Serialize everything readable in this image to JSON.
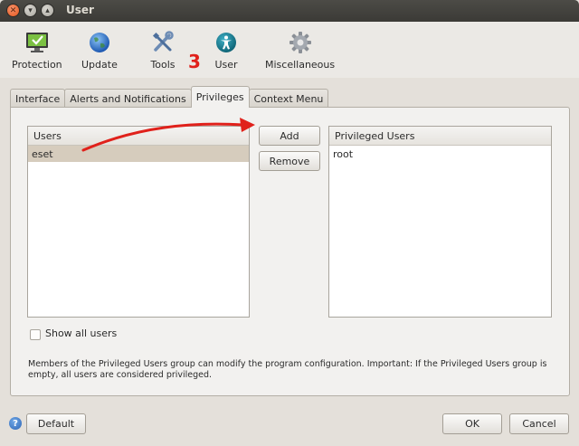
{
  "window": {
    "title": "User"
  },
  "toolbar": {
    "items": [
      {
        "label": "Protection",
        "icon": "monitor-check-icon"
      },
      {
        "label": "Update",
        "icon": "globe-icon"
      },
      {
        "label": "Tools",
        "icon": "tools-icon"
      },
      {
        "label": "User",
        "icon": "user-accessibility-icon"
      },
      {
        "label": "Miscellaneous",
        "icon": "gear-icon"
      }
    ],
    "step_number": "3"
  },
  "tabs": [
    {
      "label": "Interface"
    },
    {
      "label": "Alerts and Notifications"
    },
    {
      "label": "Privileges",
      "active": true
    },
    {
      "label": "Context Menu"
    }
  ],
  "users_list": {
    "header": "Users",
    "items": [
      "eset"
    ],
    "selected": "eset"
  },
  "privileged_list": {
    "header": "Privileged Users",
    "items": [
      "root"
    ]
  },
  "buttons": {
    "add": "Add",
    "remove": "Remove",
    "default": "Default",
    "ok": "OK",
    "cancel": "Cancel"
  },
  "show_all_users": {
    "label": "Show all users",
    "checked": false
  },
  "description": "Members of the Privileged Users group can modify the program configuration. Important: If the Privileged Users group is empty, all users are considered privileged.",
  "colors": {
    "annotation_red": "#e0211b",
    "selection": "#d6ccbd"
  }
}
